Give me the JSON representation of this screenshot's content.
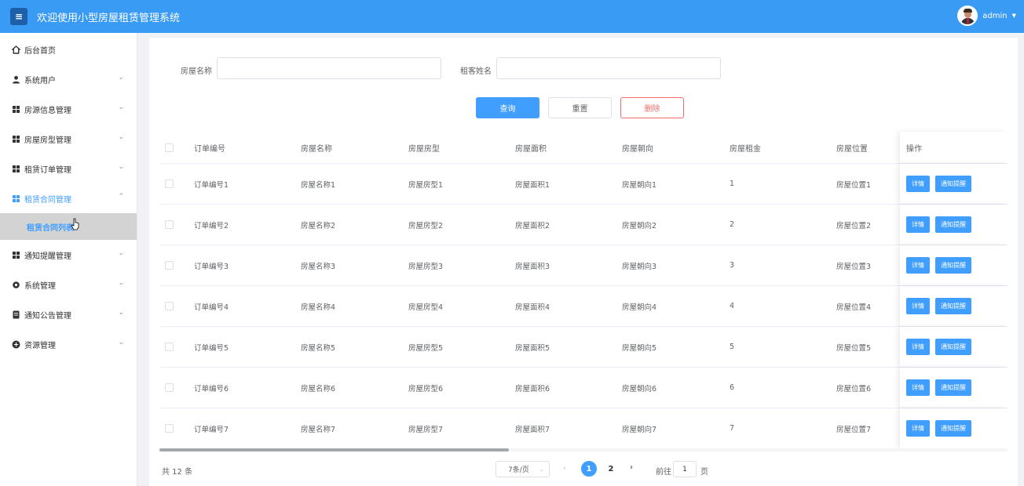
{
  "header": {
    "title": "欢迎使用小型房屋租赁管理系统",
    "user": "admin"
  },
  "sidebar": {
    "items": [
      {
        "label": "后台首页",
        "icon": "home-icon"
      },
      {
        "label": "系统用户",
        "icon": "user-icon"
      },
      {
        "label": "房源信息管理",
        "icon": "grid-icon"
      },
      {
        "label": "房屋房型管理",
        "icon": "grid-icon"
      },
      {
        "label": "租赁订单管理",
        "icon": "grid-icon"
      },
      {
        "label": "租赁合同管理",
        "icon": "grid-icon"
      },
      {
        "label": "通知提醒管理",
        "icon": "grid-icon"
      },
      {
        "label": "系统管理",
        "icon": "gear-icon"
      },
      {
        "label": "通知公告管理",
        "icon": "document-icon"
      },
      {
        "label": "资源管理",
        "icon": "plus-circle-icon"
      }
    ],
    "sub_item": "租赁合同列表"
  },
  "search": {
    "house_name_label": "房屋名称",
    "house_name_value": "",
    "tenant_label": "租客姓名",
    "tenant_value": ""
  },
  "buttons": {
    "query": "查询",
    "reset": "重置",
    "delete": "删除"
  },
  "table": {
    "columns": [
      "订单编号",
      "房屋名称",
      "房屋房型",
      "房屋面积",
      "房屋朝向",
      "房屋租金",
      "房屋位置",
      "操作"
    ],
    "rows": [
      [
        "订单编号1",
        "房屋名称1",
        "房屋房型1",
        "房屋面积1",
        "房屋朝向1",
        "1",
        "房屋位置1"
      ],
      [
        "订单编号2",
        "房屋名称2",
        "房屋房型2",
        "房屋面积2",
        "房屋朝向2",
        "2",
        "房屋位置2"
      ],
      [
        "订单编号3",
        "房屋名称3",
        "房屋房型3",
        "房屋面积3",
        "房屋朝向3",
        "3",
        "房屋位置3"
      ],
      [
        "订单编号4",
        "房屋名称4",
        "房屋房型4",
        "房屋面积4",
        "房屋朝向4",
        "4",
        "房屋位置4"
      ],
      [
        "订单编号5",
        "房屋名称5",
        "房屋房型5",
        "房屋面积5",
        "房屋朝向5",
        "5",
        "房屋位置5"
      ],
      [
        "订单编号6",
        "房屋名称6",
        "房屋房型6",
        "房屋面积6",
        "房屋朝向6",
        "6",
        "房屋位置6"
      ],
      [
        "订单编号7",
        "房屋名称7",
        "房屋房型7",
        "房屋面积7",
        "房屋朝向7",
        "7",
        "房屋位置7"
      ]
    ],
    "row_actions": [
      "详情",
      "通知提醒"
    ]
  },
  "pagination": {
    "total": "共 12 条",
    "page_size": "7条/页",
    "pages": [
      "1",
      "2"
    ],
    "current": "1",
    "goto_label": "前往",
    "goto_value": "1",
    "goto_suffix": "页"
  },
  "colors": {
    "header": "#3a9bf5",
    "primary": "#409eff",
    "danger": "#f56c6c"
  }
}
